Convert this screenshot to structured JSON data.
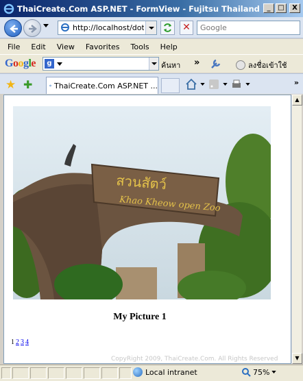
{
  "window": {
    "title": "ThaiCreate.Com ASP.NET - FormView - Fujitsu Thailand",
    "min_label": "_",
    "max_label": "□",
    "close_label": "X"
  },
  "address_bar": {
    "url": "http://localhost/dotne",
    "search_placeholder": "Google"
  },
  "menu": {
    "items": [
      "File",
      "Edit",
      "View",
      "Favorites",
      "Tools",
      "Help"
    ]
  },
  "google_toolbar": {
    "logo": "Google",
    "search_button": "ค้นหา",
    "more": "»",
    "sign_in": "ลงชื่อเข้าใช้"
  },
  "tabs": {
    "active_tab_label": "ThaiCreate.Com ASP.NET ...",
    "more": "»"
  },
  "page": {
    "caption": "My Picture 1",
    "pager": {
      "current": "1",
      "links": [
        "2",
        "3",
        "4"
      ]
    },
    "copyright": "CopyRight 2009, ThaiCreate.Com. All Rights Reserved",
    "photo_sign_text": "Khao Kheow open Zoo"
  },
  "status_bar": {
    "zone": "Local intranet",
    "zoom": "75%"
  },
  "colors": {
    "titlebar_start": "#0a246a",
    "link": "#0000ee",
    "chrome": "#ece9d8"
  }
}
